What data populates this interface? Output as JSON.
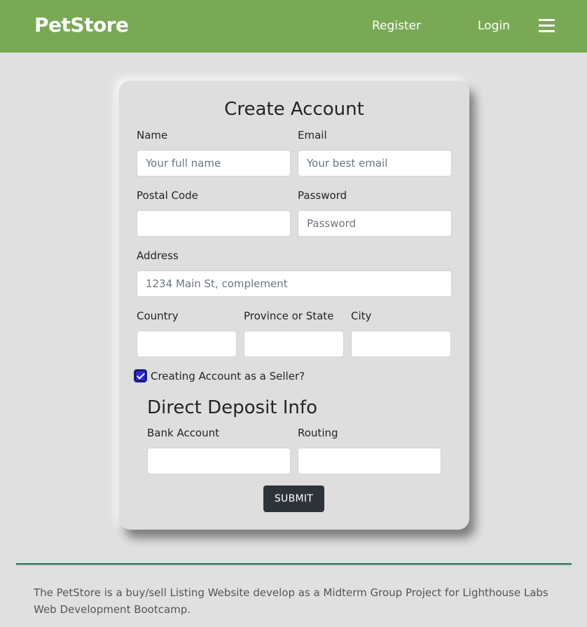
{
  "navbar": {
    "brand": "PetStore",
    "register_label": "Register",
    "login_label": "Login",
    "menu_icon": "hamburger-menu-icon",
    "background": "#79a955"
  },
  "form": {
    "title": "Create Account",
    "name": {
      "label": "Name",
      "placeholder": "Your full name",
      "value": ""
    },
    "email": {
      "label": "Email",
      "placeholder": "Your best email",
      "value": ""
    },
    "postal_code": {
      "label": "Postal Code",
      "placeholder": "",
      "value": ""
    },
    "password": {
      "label": "Password",
      "placeholder": "Password",
      "value": ""
    },
    "address": {
      "label": "Address",
      "placeholder": "1234 Main St, complement",
      "value": ""
    },
    "country": {
      "label": "Country",
      "placeholder": "",
      "value": ""
    },
    "province": {
      "label": "Province or State",
      "placeholder": "",
      "value": ""
    },
    "city": {
      "label": "City",
      "placeholder": "",
      "value": ""
    },
    "seller": {
      "label": "Creating Account as a Seller?",
      "checked": true
    },
    "deposit_title": "Direct Deposit Info",
    "bank_account": {
      "label": "Bank Account",
      "placeholder": "",
      "value": ""
    },
    "routing": {
      "label": "Routing",
      "placeholder": "",
      "value": ""
    },
    "submit_label": "SUBMIT"
  },
  "footer": {
    "text": "The PetStore is a buy/sell Listing Website develop as a Midterm Group Project for Lighthouse Labs Web Development Bootcamp.",
    "rule_color": "#1a6b48"
  }
}
